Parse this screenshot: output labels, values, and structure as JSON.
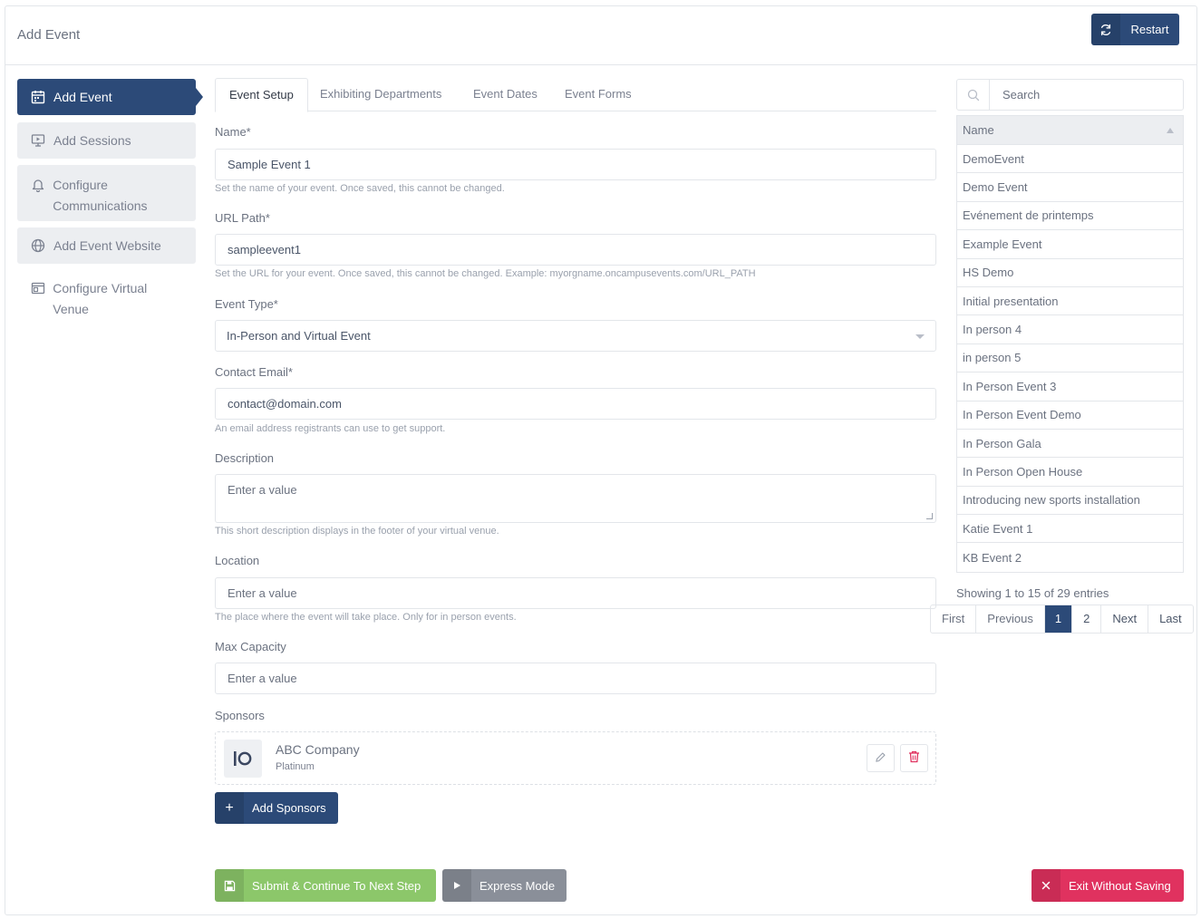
{
  "header": {
    "title": "Add Event",
    "restart_label": "Restart"
  },
  "sidebar": {
    "items": [
      {
        "label": "Add Event",
        "icon": "calendar-icon",
        "state": "active"
      },
      {
        "label": "Add Sessions",
        "icon": "presentation-icon",
        "state": "pending"
      },
      {
        "label": "Configure Communications",
        "icon": "bell-icon",
        "state": "pending"
      },
      {
        "label": "Add Event Website",
        "icon": "globe-icon",
        "state": "pending"
      },
      {
        "label": "Configure Virtual Venue",
        "icon": "window-icon",
        "state": "plain"
      }
    ]
  },
  "tabs": [
    "Event Setup",
    "Exhibiting Departments",
    "Event Dates",
    "Event Forms"
  ],
  "form": {
    "name": {
      "label": "Name*",
      "value": "Sample Event 1",
      "help": "Set the name of your event. Once saved, this cannot be changed."
    },
    "url_path": {
      "label": "URL Path*",
      "value": "sampleevent1",
      "help": "Set the URL for your event. Once saved, this cannot be changed. Example: myorgname.oncampusevents.com/URL_PATH"
    },
    "event_type": {
      "label": "Event Type*",
      "value": "In-Person and Virtual Event"
    },
    "contact_email": {
      "label": "Contact Email*",
      "value": "contact@domain.com",
      "help": "An email address registrants can use to get support."
    },
    "description": {
      "label": "Description",
      "placeholder": "Enter a value",
      "help": "This short description displays in the footer of your virtual venue."
    },
    "location": {
      "label": "Location",
      "placeholder": "Enter a value",
      "help": "The place where the event will take place. Only for in person events."
    },
    "max_capacity": {
      "label": "Max Capacity",
      "placeholder": "Enter a value"
    },
    "sponsors": {
      "label": "Sponsors",
      "items": [
        {
          "name": "ABC Company",
          "tier": "Platinum"
        }
      ],
      "add_label": "Add Sponsors"
    }
  },
  "actions": {
    "submit_label": "Submit & Continue To Next Step",
    "express_label": "Express Mode",
    "exit_label": "Exit Without Saving"
  },
  "events_table": {
    "search_placeholder": "Search",
    "column": "Name",
    "rows": [
      "DemoEvent",
      "Demo Event",
      "Evénement de printemps",
      "Example Event",
      "HS Demo",
      "Initial presentation",
      "In person 4",
      "in person 5",
      "In Person Event 3",
      "In Person Event Demo",
      "In Person Gala",
      "In Person Open House",
      "Introducing new sports installation",
      "Katie Event 1",
      "KB Event 2"
    ],
    "info": "Showing 1 to 15 of 29 entries",
    "pagination": {
      "first": "First",
      "previous": "Previous",
      "pages": [
        "1",
        "2"
      ],
      "current_page": "1",
      "next": "Next",
      "last": "Last"
    }
  },
  "colors": {
    "primary": "#2c4a78",
    "success": "#8cc76a",
    "secondary": "#8a8f99",
    "danger": "#e0325f"
  }
}
